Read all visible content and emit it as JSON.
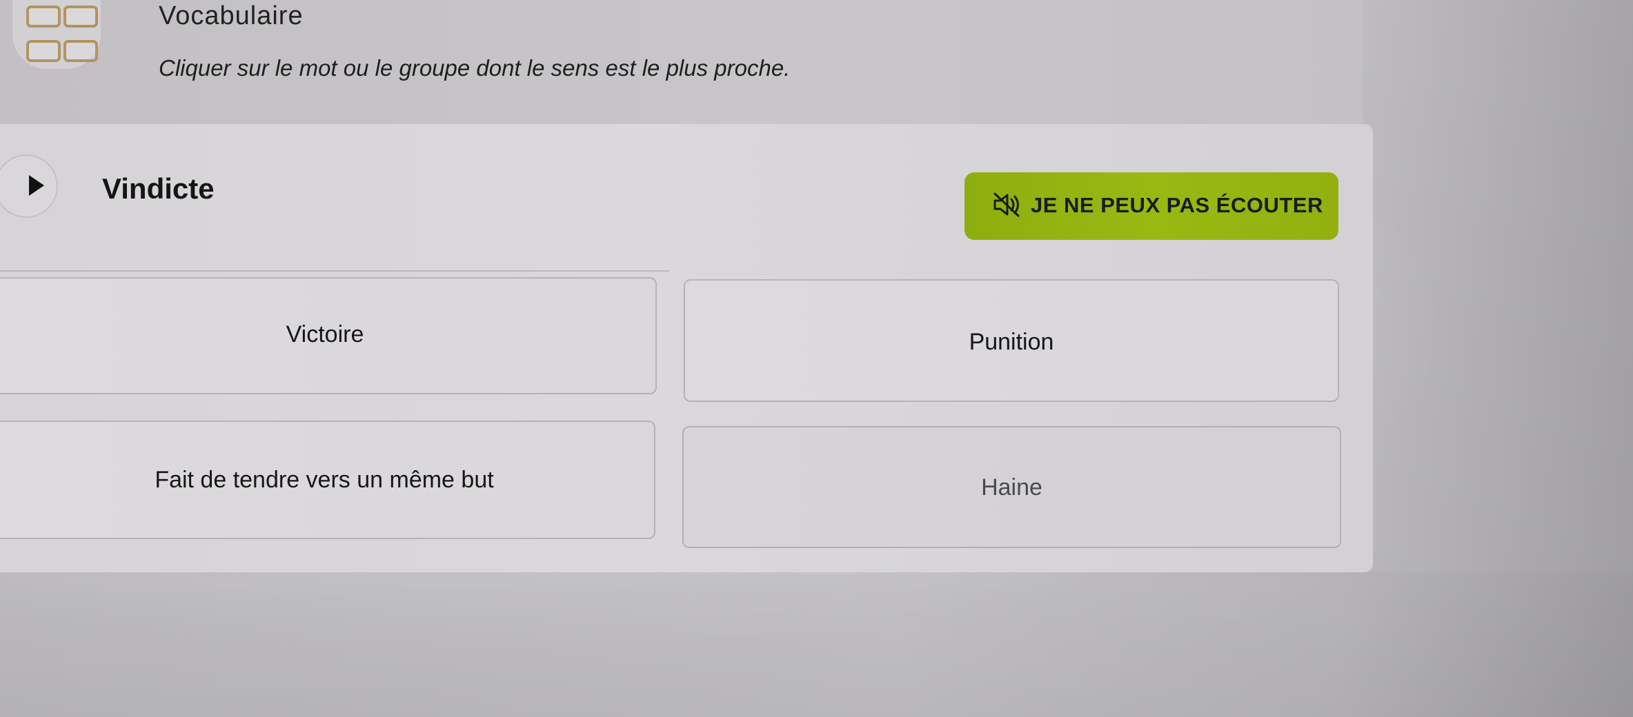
{
  "header": {
    "title": "Vocabulaire",
    "instruction": "Cliquer sur le mot ou le groupe dont le sens est le plus proche."
  },
  "question": {
    "word": "Vindicte",
    "play_icon": "play-icon"
  },
  "cant_listen_button": {
    "label": "JE NE PEUX PAS ÉCOUTER",
    "icon": "speaker-muted-icon",
    "color": "#9ab812"
  },
  "options": [
    {
      "label": "Victoire"
    },
    {
      "label": "Punition"
    },
    {
      "label": "Fait de tendre vers un même but"
    },
    {
      "label": "Haine"
    }
  ],
  "colors": {
    "accent": "#9ab812",
    "icon_gold": "#b19560"
  }
}
